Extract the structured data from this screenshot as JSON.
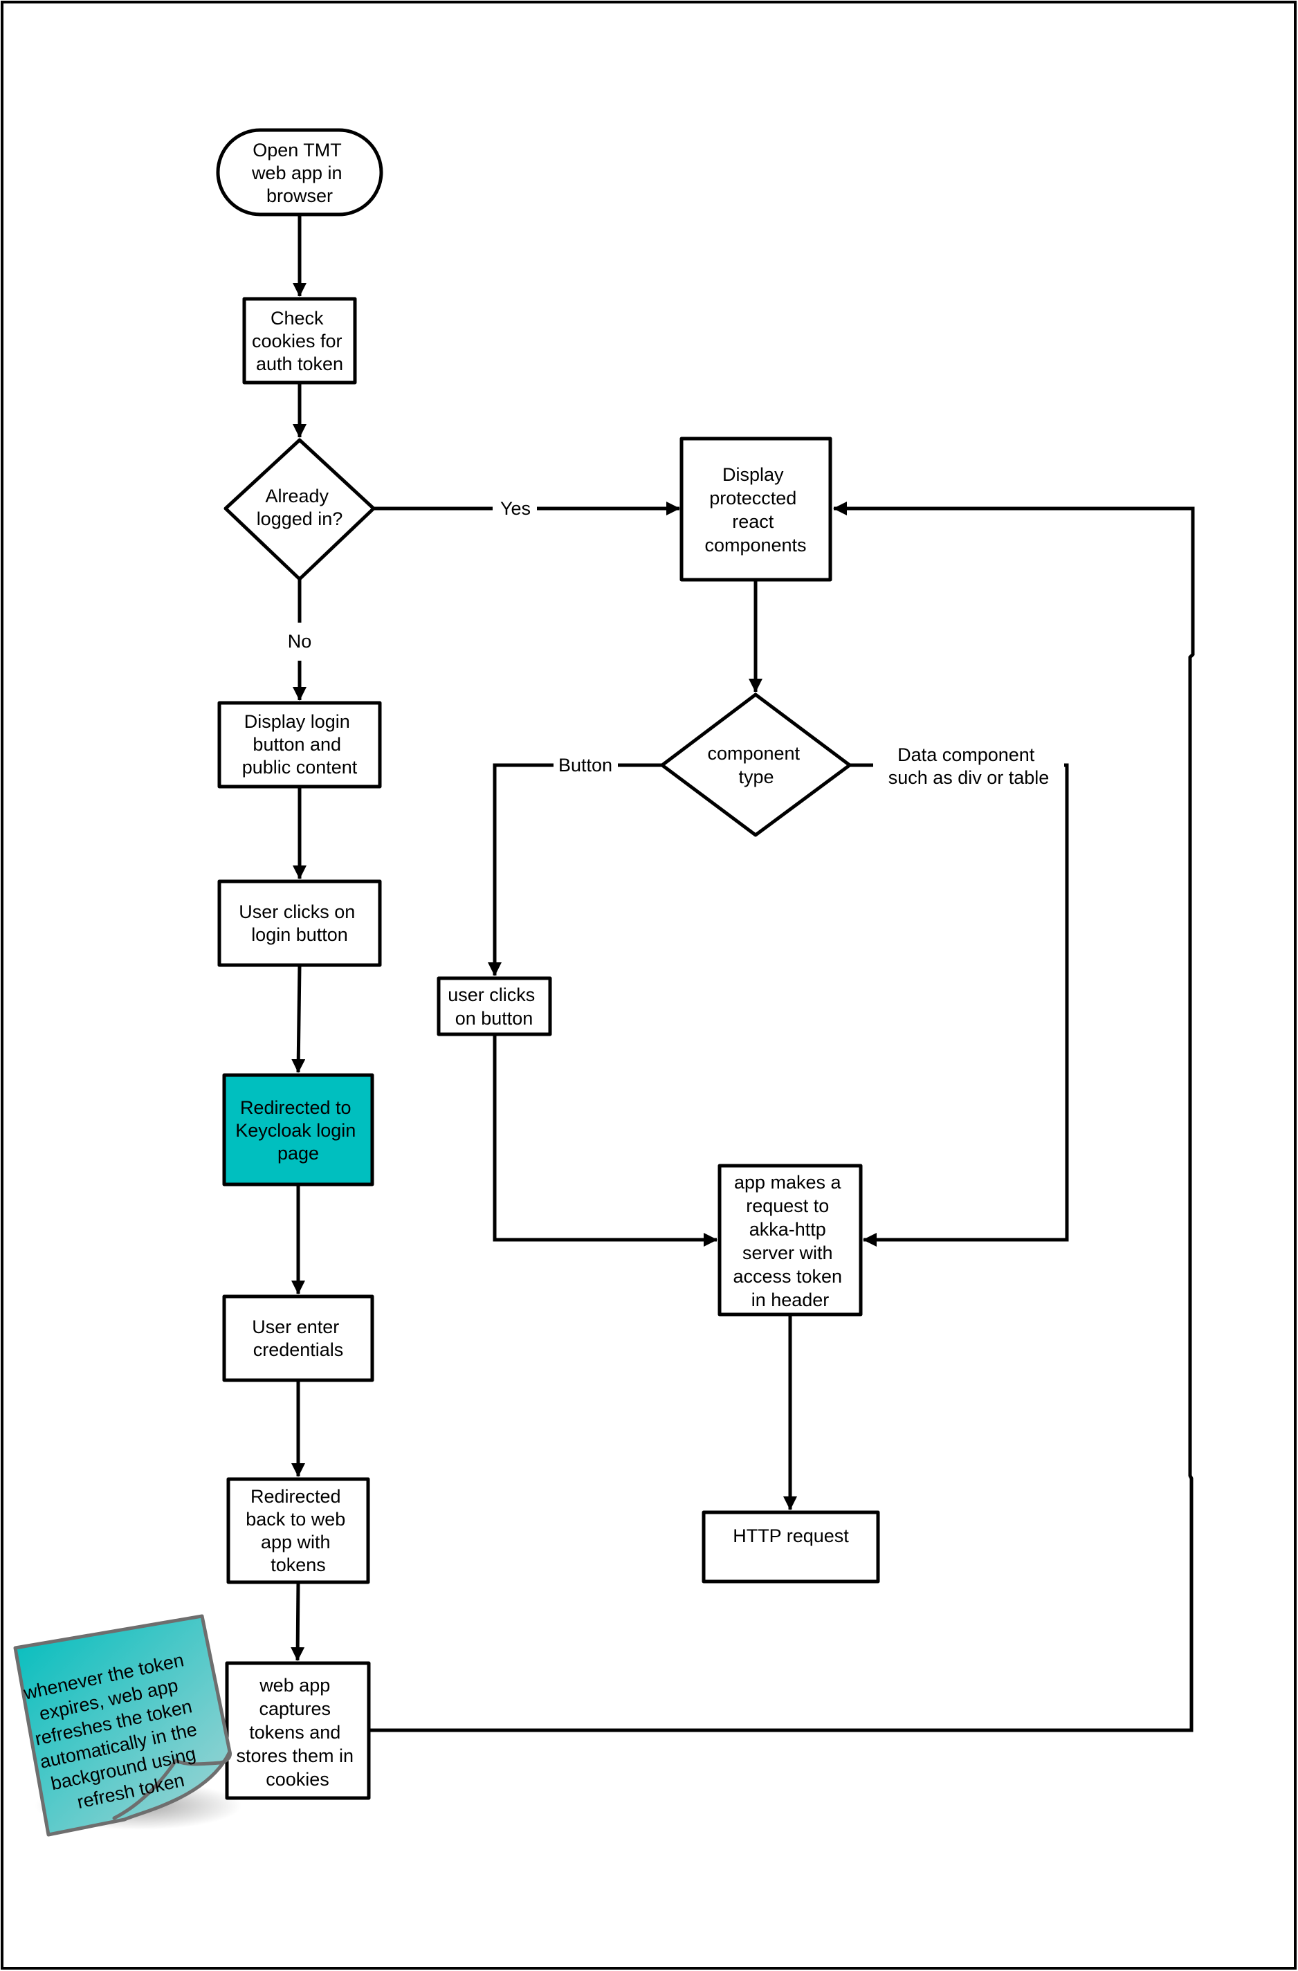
{
  "diagram": {
    "type": "flowchart",
    "colors": {
      "stroke": "#000000",
      "highlight_fill": "#00BFBF",
      "note_fill_start": "#00BDBD",
      "note_fill_end": "#A6D5D5",
      "note_stroke": "#6E6E6E",
      "background": "#FFFFFF"
    },
    "nodes": {
      "open_app": {
        "shape": "terminal",
        "lines": [
          "Open TMT",
          "web app in",
          "browser"
        ]
      },
      "check_cookies": {
        "shape": "process",
        "lines": [
          "Check",
          "cookies for",
          "auth token"
        ]
      },
      "already_logged_in": {
        "shape": "decision",
        "lines": [
          "Already",
          "logged in?"
        ]
      },
      "display_login": {
        "shape": "process",
        "lines": [
          "Display login",
          "button and",
          "public content"
        ]
      },
      "user_clicks_login": {
        "shape": "process",
        "lines": [
          "User clicks on",
          "login button"
        ]
      },
      "redirect_keycloak": {
        "shape": "process",
        "highlighted": true,
        "lines": [
          "Redirected to",
          "Keycloak login",
          "page"
        ]
      },
      "enter_credentials": {
        "shape": "process",
        "lines": [
          "User enter",
          "credentials"
        ]
      },
      "redirect_back": {
        "shape": "process",
        "lines": [
          "Redirected",
          "back to web",
          "app with",
          "tokens"
        ]
      },
      "capture_tokens": {
        "shape": "process",
        "lines": [
          "web app",
          "captures",
          "tokens and",
          "stores them in",
          "cookies"
        ]
      },
      "display_protected": {
        "shape": "process",
        "lines": [
          "Display",
          "proteccted",
          "react",
          "components"
        ]
      },
      "component_type": {
        "shape": "decision",
        "lines": [
          "component",
          "type"
        ]
      },
      "user_clicks_button": {
        "shape": "process",
        "lines": [
          "user clicks",
          "on button"
        ]
      },
      "app_request": {
        "shape": "process",
        "lines": [
          "app makes a",
          "request to",
          "akka-http",
          "server with",
          "access token",
          "in header"
        ]
      },
      "http_request": {
        "shape": "process",
        "lines": [
          "HTTP request"
        ]
      }
    },
    "edges": [
      {
        "from": "open_app",
        "to": "check_cookies",
        "label": ""
      },
      {
        "from": "check_cookies",
        "to": "already_logged_in",
        "label": ""
      },
      {
        "from": "already_logged_in",
        "to": "display_protected",
        "label": "Yes"
      },
      {
        "from": "already_logged_in",
        "to": "display_login",
        "label": "No"
      },
      {
        "from": "display_login",
        "to": "user_clicks_login",
        "label": ""
      },
      {
        "from": "user_clicks_login",
        "to": "redirect_keycloak",
        "label": ""
      },
      {
        "from": "redirect_keycloak",
        "to": "enter_credentials",
        "label": ""
      },
      {
        "from": "enter_credentials",
        "to": "redirect_back",
        "label": ""
      },
      {
        "from": "redirect_back",
        "to": "capture_tokens",
        "label": ""
      },
      {
        "from": "capture_tokens",
        "to": "display_protected",
        "label": ""
      },
      {
        "from": "display_protected",
        "to": "component_type",
        "label": ""
      },
      {
        "from": "component_type",
        "to": "user_clicks_button",
        "label": "Button"
      },
      {
        "from": "component_type",
        "to": "app_request",
        "label_lines": [
          "Data component",
          "such as div or table"
        ]
      },
      {
        "from": "user_clicks_button",
        "to": "app_request",
        "label": ""
      },
      {
        "from": "app_request",
        "to": "http_request",
        "label": ""
      }
    ],
    "labels": {
      "yes": "Yes",
      "no": "No",
      "button": "Button",
      "data_component": [
        "Data component",
        "such as div or table"
      ]
    },
    "note": {
      "lines": [
        "whenever the token",
        "expires, web app",
        "refreshes the token",
        "automatically in the",
        "background using",
        "refresh token"
      ]
    }
  }
}
